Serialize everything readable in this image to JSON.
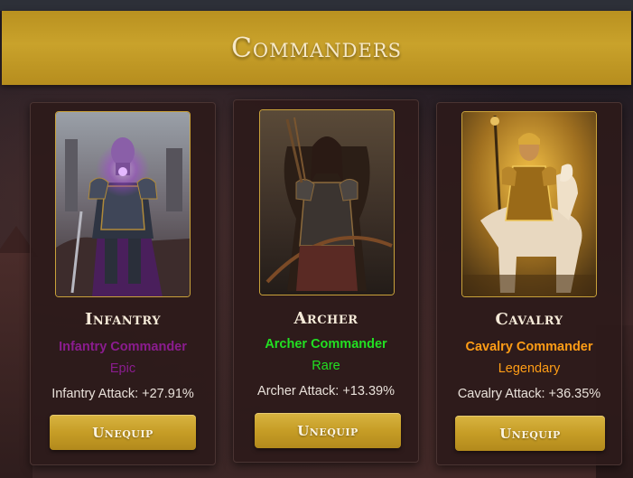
{
  "header": {
    "title": "Commanders"
  },
  "colors": {
    "gold": "#c9a22b",
    "epic": "#8b1c8f",
    "rare": "#22e022",
    "legendary": "#ff9d16"
  },
  "cards": [
    {
      "name": "Infantry",
      "title": "Infantry Commander",
      "rarity": "Epic",
      "bonus": "Infantry Attack: +27.91%",
      "button": "Unequip"
    },
    {
      "name": "Archer",
      "title": "Archer Commander",
      "rarity": "Rare",
      "bonus": "Archer Attack: +13.39%",
      "button": "Unequip"
    },
    {
      "name": "Cavalry",
      "title": "Cavalry Commander",
      "rarity": "Legendary",
      "bonus": "Cavalry Attack: +36.35%",
      "button": "Unequip"
    }
  ]
}
